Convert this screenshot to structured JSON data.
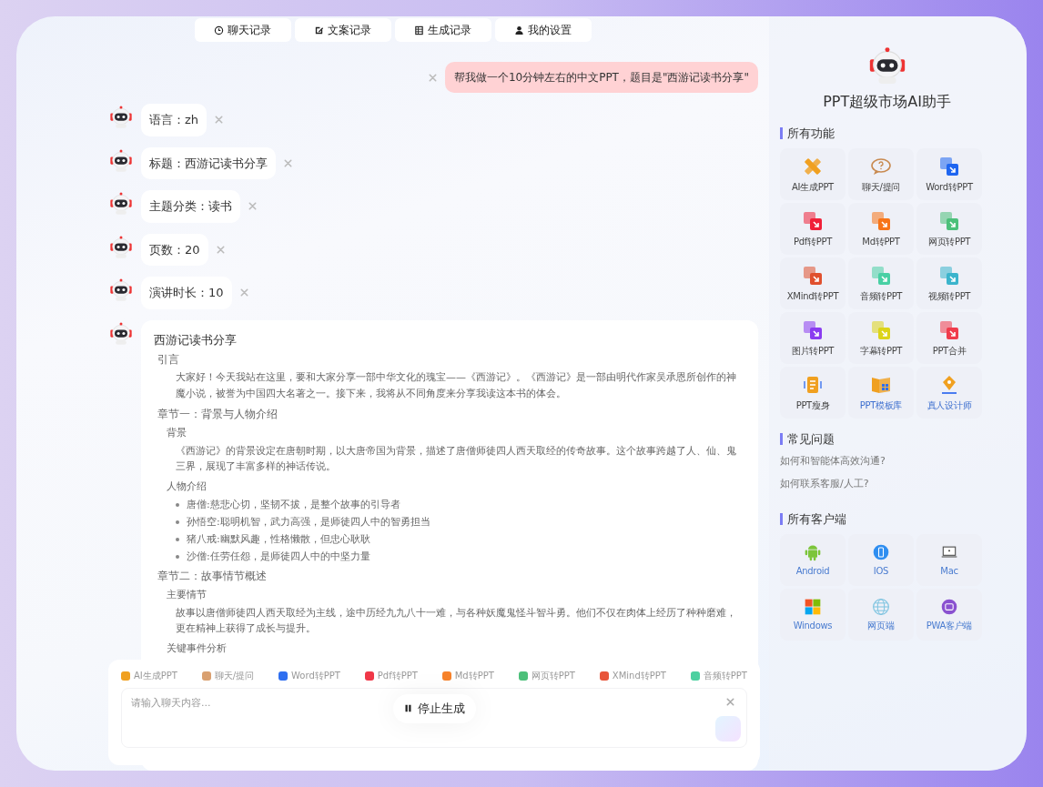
{
  "nav_tabs": [
    {
      "label": "聊天记录"
    },
    {
      "label": "文案记录"
    },
    {
      "label": "生成记录"
    },
    {
      "label": "我的设置"
    }
  ],
  "user_message": {
    "text": "帮我做一个10分钟左右的中文PPT，题目是\"西游记读书分享\""
  },
  "bot_messages": [
    {
      "text": "语言：zh"
    },
    {
      "text": "标题：西游记读书分享"
    },
    {
      "text": "主题分类：读书"
    },
    {
      "text": "页数：20"
    },
    {
      "text": "演讲时长：10"
    }
  ],
  "document": {
    "blocks": [
      {
        "kind": "title",
        "text": "西游记读书分享"
      },
      {
        "kind": "h1",
        "text": "引言"
      },
      {
        "kind": "para",
        "text": "大家好！今天我站在这里，要和大家分享一部中华文化的瑰宝——《西游记》。《西游记》是一部由明代作家吴承恩所创作的神魔小说，被誉为中国四大名著之一。接下来，我将从不同角度来分享我读这本书的体会。"
      },
      {
        "kind": "h1",
        "text": "章节一：背景与人物介绍"
      },
      {
        "kind": "h2",
        "text": "背景"
      },
      {
        "kind": "para",
        "text": "《西游记》的背景设定在唐朝时期，以大唐帝国为背景，描述了唐僧师徒四人西天取经的传奇故事。这个故事跨越了人、仙、鬼三界，展现了丰富多样的神话传说。"
      },
      {
        "kind": "h2",
        "text": "人物介绍"
      },
      {
        "kind": "bullet",
        "text": "唐僧:慈悲心切，坚韧不拔，是整个故事的引导者"
      },
      {
        "kind": "bullet",
        "text": "孙悟空:聪明机智，武力高强，是师徒四人中的智勇担当"
      },
      {
        "kind": "bullet",
        "text": "猪八戒:幽默风趣，性格懒散，但忠心耿耿"
      },
      {
        "kind": "bullet",
        "text": "沙僧:任劳任怨，是师徒四人中的中坚力量"
      },
      {
        "kind": "h1",
        "text": "章节二：故事情节概述"
      },
      {
        "kind": "h2",
        "text": "主要情节"
      },
      {
        "kind": "para",
        "text": "故事以唐僧师徒四人西天取经为主线，途中历经九九八十一难，与各种妖魔鬼怪斗智斗勇。他们不仅在肉体上经历了种种磨难，更在精神上获得了成长与提升。"
      },
      {
        "kind": "h2",
        "text": "关键事件分析"
      }
    ]
  },
  "composer": {
    "chips": [
      {
        "label": "AI生成PPT",
        "color": "#f0a020"
      },
      {
        "label": "聊天/提问",
        "color": "#d9a070"
      },
      {
        "label": "Word转PPT",
        "color": "#2f6ff0"
      },
      {
        "label": "Pdf转PPT",
        "color": "#f03848"
      },
      {
        "label": "Md转PPT",
        "color": "#f7822a"
      },
      {
        "label": "网页转PPT",
        "color": "#4cc07a"
      },
      {
        "label": "XMind转PPT",
        "color": "#e8553a"
      },
      {
        "label": "音频转PPT",
        "color": "#4dd0a0"
      }
    ],
    "placeholder": "请输入聊天内容...",
    "stop_label": "停止生成"
  },
  "sidebar": {
    "app_title": "PPT超级市场AI助手",
    "features": {
      "title": "所有功能",
      "items": [
        {
          "label": "AI生成PPT",
          "color": "#f0a020",
          "kind": "tool"
        },
        {
          "label": "聊天/提问",
          "color": "#c88a50",
          "kind": "tool"
        },
        {
          "label": "Word转PPT",
          "color": "#1f66f0",
          "kind": "tool"
        },
        {
          "label": "Pdf转PPT",
          "color": "#f02038",
          "kind": "tool"
        },
        {
          "label": "Md转PPT",
          "color": "#f77418",
          "kind": "tool"
        },
        {
          "label": "网页转PPT",
          "color": "#4cc07a",
          "kind": "tool"
        },
        {
          "label": "XMind转PPT",
          "color": "#e0502e",
          "kind": "tool"
        },
        {
          "label": "音频转PPT",
          "color": "#48d0a4",
          "kind": "tool"
        },
        {
          "label": "视频转PPT",
          "color": "#3bb4cc",
          "kind": "tool"
        },
        {
          "label": "图片转PPT",
          "color": "#8a3cf0",
          "kind": "tool"
        },
        {
          "label": "字幕转PPT",
          "color": "#dcd418",
          "kind": "tool"
        },
        {
          "label": "PPT合并",
          "color": "#f03c4c",
          "kind": "tool"
        },
        {
          "label": "PPT瘦身",
          "color": "#f0a020",
          "kind": "tool"
        },
        {
          "label": "PPT模板库",
          "color": "#f0a020",
          "kind": "link"
        },
        {
          "label": "真人设计师",
          "color": "#f0a020",
          "kind": "link"
        }
      ]
    },
    "faq": {
      "title": "常见问题",
      "items": [
        {
          "text": "如何和智能体高效沟通?"
        },
        {
          "text": "如何联系客服/人工?"
        }
      ]
    },
    "clients": {
      "title": "所有客户端",
      "items": [
        {
          "label": "Android"
        },
        {
          "label": "IOS"
        },
        {
          "label": "Mac"
        },
        {
          "label": "Windows"
        },
        {
          "label": "网页端"
        },
        {
          "label": "PWA客户端"
        }
      ]
    }
  }
}
